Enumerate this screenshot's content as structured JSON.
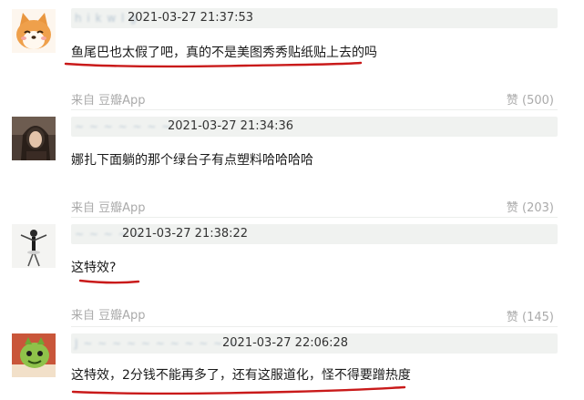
{
  "comments": [
    {
      "username": "h i k w l g",
      "time": "2021-03-27 21:37:53",
      "text": "鱼尾巴也太假了吧，真的不是美图秀秀贴纸贴上去的吗",
      "source": "来自 豆瓣App",
      "like": "赞 (500)",
      "avatar": "shiba-dog"
    },
    {
      "username": "~ ~ ~ ~ ~ ~ ~",
      "time": "2021-03-27 21:34:36",
      "text": "娜扎下面躺的那个绿台子有点塑料哈哈哈哈",
      "source": "来自 豆瓣App",
      "like": "赞 (203)",
      "avatar": "portrait-dark"
    },
    {
      "username": "~ ~ ~ ~ ~",
      "time": "2021-03-27 21:38:22",
      "text": "这特效?",
      "source": "来自 豆瓣App",
      "like": "赞 (145)",
      "avatar": "dancer"
    },
    {
      "username": "J ~ ~ ~ ~ ~ ~ ~ ~ ~ ~ ~",
      "time": "2021-03-27 22:06:28",
      "text": "这特效，2分钱不能再多了，还有这服道化，怪不得要蹭热度",
      "avatar": "green-creature"
    }
  ],
  "colors": {
    "underline": "#c91a1a",
    "header_bg": "#f0f2f0",
    "meta_text": "#aaaaaa"
  }
}
